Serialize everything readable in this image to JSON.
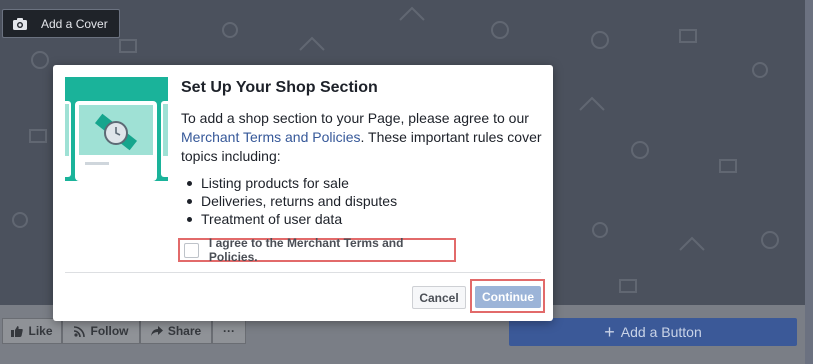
{
  "cover": {
    "add_cover_label": "Add a Cover",
    "camera_icon": "camera-icon"
  },
  "action_bar": {
    "like_label": "Like",
    "follow_label": "Follow",
    "share_label": "Share",
    "more_label": "···",
    "add_button_label": "Add a Button",
    "accent": "#3b5998"
  },
  "modal": {
    "title": "Set Up Your Shop Section",
    "intro_before_link": "To add a shop section to your Page, please agree to our ",
    "intro_link": "Merchant Terms and Policies",
    "intro_after_link": ". These important rules cover topics including:",
    "bullets": [
      "Listing products for sale",
      "Deliveries, returns and disputes",
      "Treatment of user data"
    ],
    "agree_label": "I agree to the Merchant Terms and Policies.",
    "agree_checked": false,
    "cancel_label": "Cancel",
    "continue_label": "Continue",
    "link_color": "#365899",
    "highlight_color": "#e26a6a",
    "illustration_color": "#1ab39a"
  }
}
